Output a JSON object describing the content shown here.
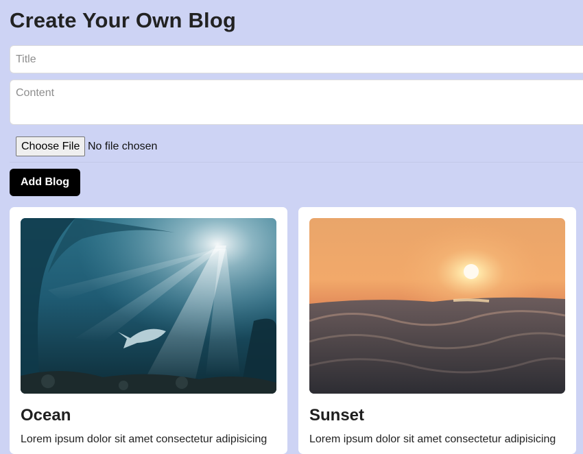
{
  "page": {
    "title": "Create Your Own Blog"
  },
  "form": {
    "title_placeholder": "Title",
    "title_value": "",
    "content_placeholder": "Content",
    "content_value": "",
    "file_button_label": "Choose File",
    "file_status": "No file chosen",
    "add_button_label": "Add Blog"
  },
  "blogs": [
    {
      "title": "Ocean",
      "text": "Lorem ipsum dolor sit amet consectetur adipisicing",
      "image": "underwater-ocean-image"
    },
    {
      "title": "Sunset",
      "text": "Lorem ipsum dolor sit amet consectetur adipisicing",
      "image": "sunset-over-sea-image"
    }
  ],
  "colors": {
    "background": "#cdd3f4",
    "button": "#000000",
    "card": "#ffffff"
  }
}
